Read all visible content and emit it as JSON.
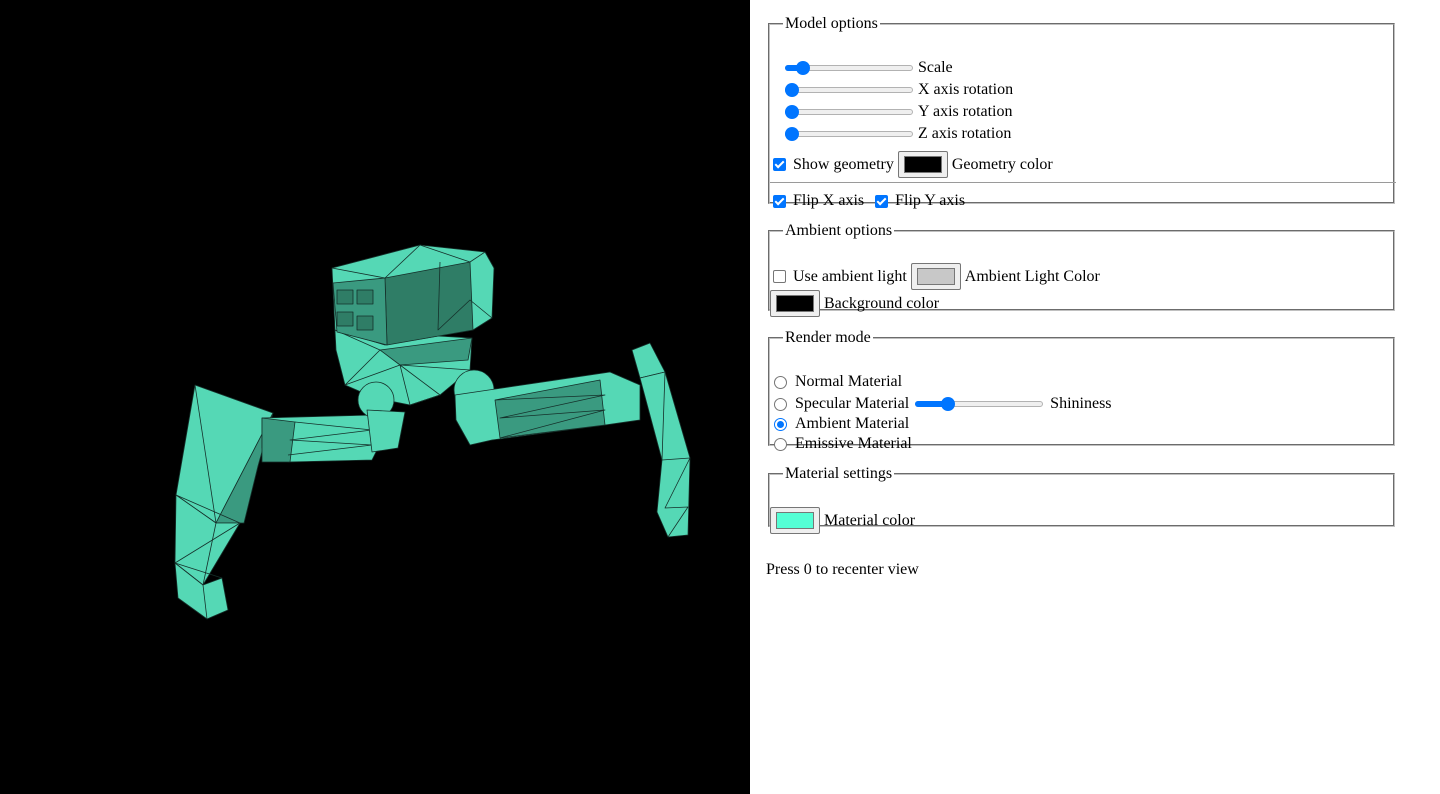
{
  "model_options": {
    "legend": "Model options",
    "scale_label": "Scale",
    "x_rotation_label": "X axis rotation",
    "y_rotation_label": "Y axis rotation",
    "z_rotation_label": "Z axis rotation",
    "scale_value": 0.1,
    "x_rotation_value": 0,
    "y_rotation_value": 0,
    "z_rotation_value": 0,
    "show_geometry_label": "Show geometry",
    "show_geometry_checked": true,
    "geometry_color_label": "Geometry color",
    "geometry_color": "#000000",
    "flip_x_label": "Flip X axis",
    "flip_x_checked": true,
    "flip_y_label": "Flip Y axis",
    "flip_y_checked": true
  },
  "ambient_options": {
    "legend": "Ambient options",
    "use_ambient_label": "Use ambient light",
    "use_ambient_checked": false,
    "ambient_color_label": "Ambient Light Color",
    "ambient_color": "#c8c8c8",
    "background_color_label": "Background color",
    "background_color": "#000000"
  },
  "render_mode": {
    "legend": "Render mode",
    "options": [
      {
        "label": "Normal Material",
        "selected": false
      },
      {
        "label": "Specular Material",
        "selected": false
      },
      {
        "label": "Ambient Material",
        "selected": true
      },
      {
        "label": "Emissive Material",
        "selected": false
      }
    ],
    "shininess_label": "Shininess",
    "shininess_value": 0.23
  },
  "material_settings": {
    "legend": "Material settings",
    "material_color_label": "Material color",
    "material_color": "#55ffd5"
  },
  "hint": "Press 0 to recenter view",
  "colors": {
    "accent": "#0075ff",
    "model_light": "#55d8b5",
    "model_dark": "#2f7d66",
    "viewport_bg": "#000000"
  }
}
